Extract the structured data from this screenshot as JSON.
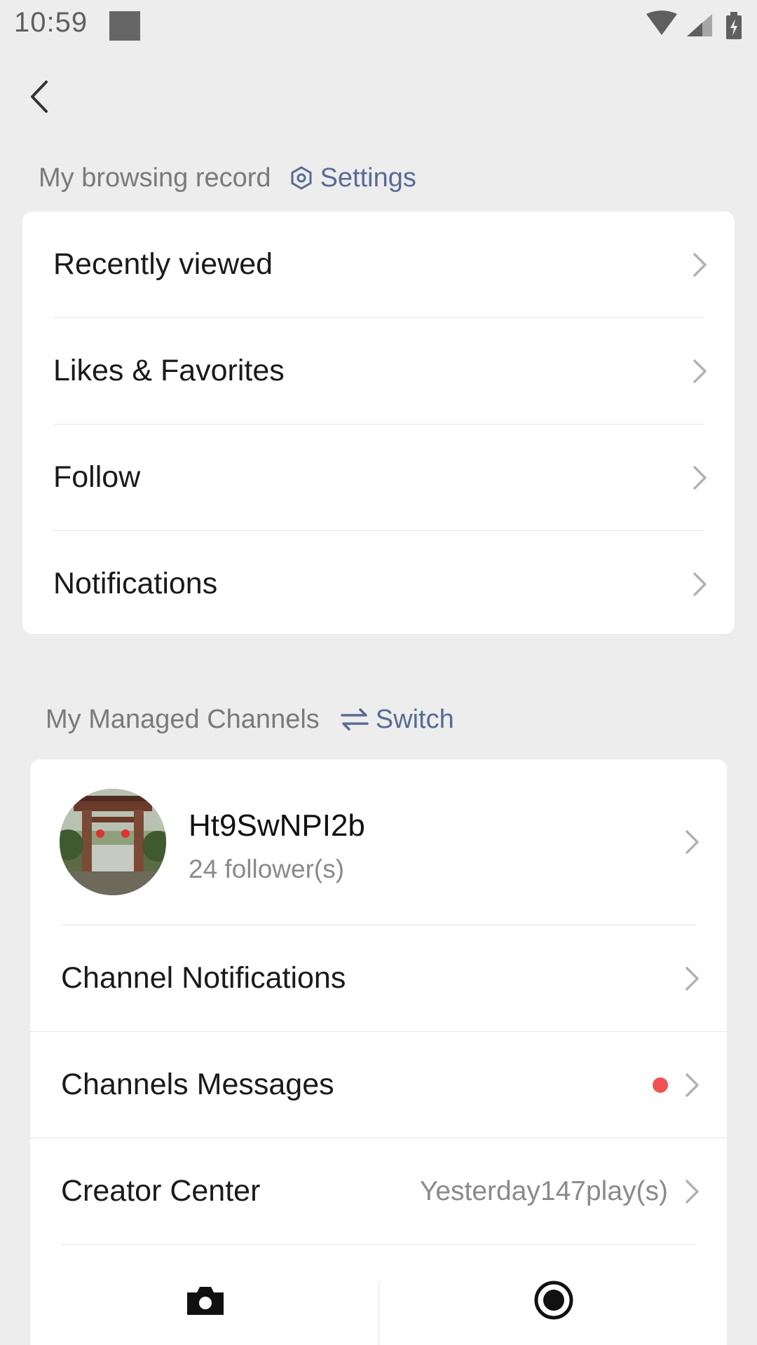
{
  "status_bar": {
    "time": "10:59",
    "icons": [
      "wifi-icon",
      "signal-icon",
      "battery-charging-icon"
    ]
  },
  "browsing_section": {
    "title": "My browsing record",
    "action_label": "Settings",
    "action_icon": "settings-hex-icon",
    "items": [
      {
        "label": "Recently viewed"
      },
      {
        "label": "Likes & Favorites"
      },
      {
        "label": "Follow"
      },
      {
        "label": "Notifications"
      }
    ]
  },
  "channels_section": {
    "title": "My Managed Channels",
    "action_label": "Switch",
    "action_icon": "switch-arrows-icon",
    "channel": {
      "name": "Ht9SwNPI2b",
      "followers": "24 follower(s)"
    },
    "items": [
      {
        "label": "Channel Notifications"
      },
      {
        "label": "Channels Messages",
        "badge": "red-dot"
      },
      {
        "label": "Creator Center",
        "extra": "Yesterday147play(s)"
      }
    ],
    "bottom_actions": [
      "camera-icon",
      "record-icon"
    ]
  },
  "colors": {
    "background": "#ededed",
    "card": "#ffffff",
    "link_blue": "#576b95",
    "red_dot": "#f25252",
    "muted_text": "#8a8a8a"
  }
}
